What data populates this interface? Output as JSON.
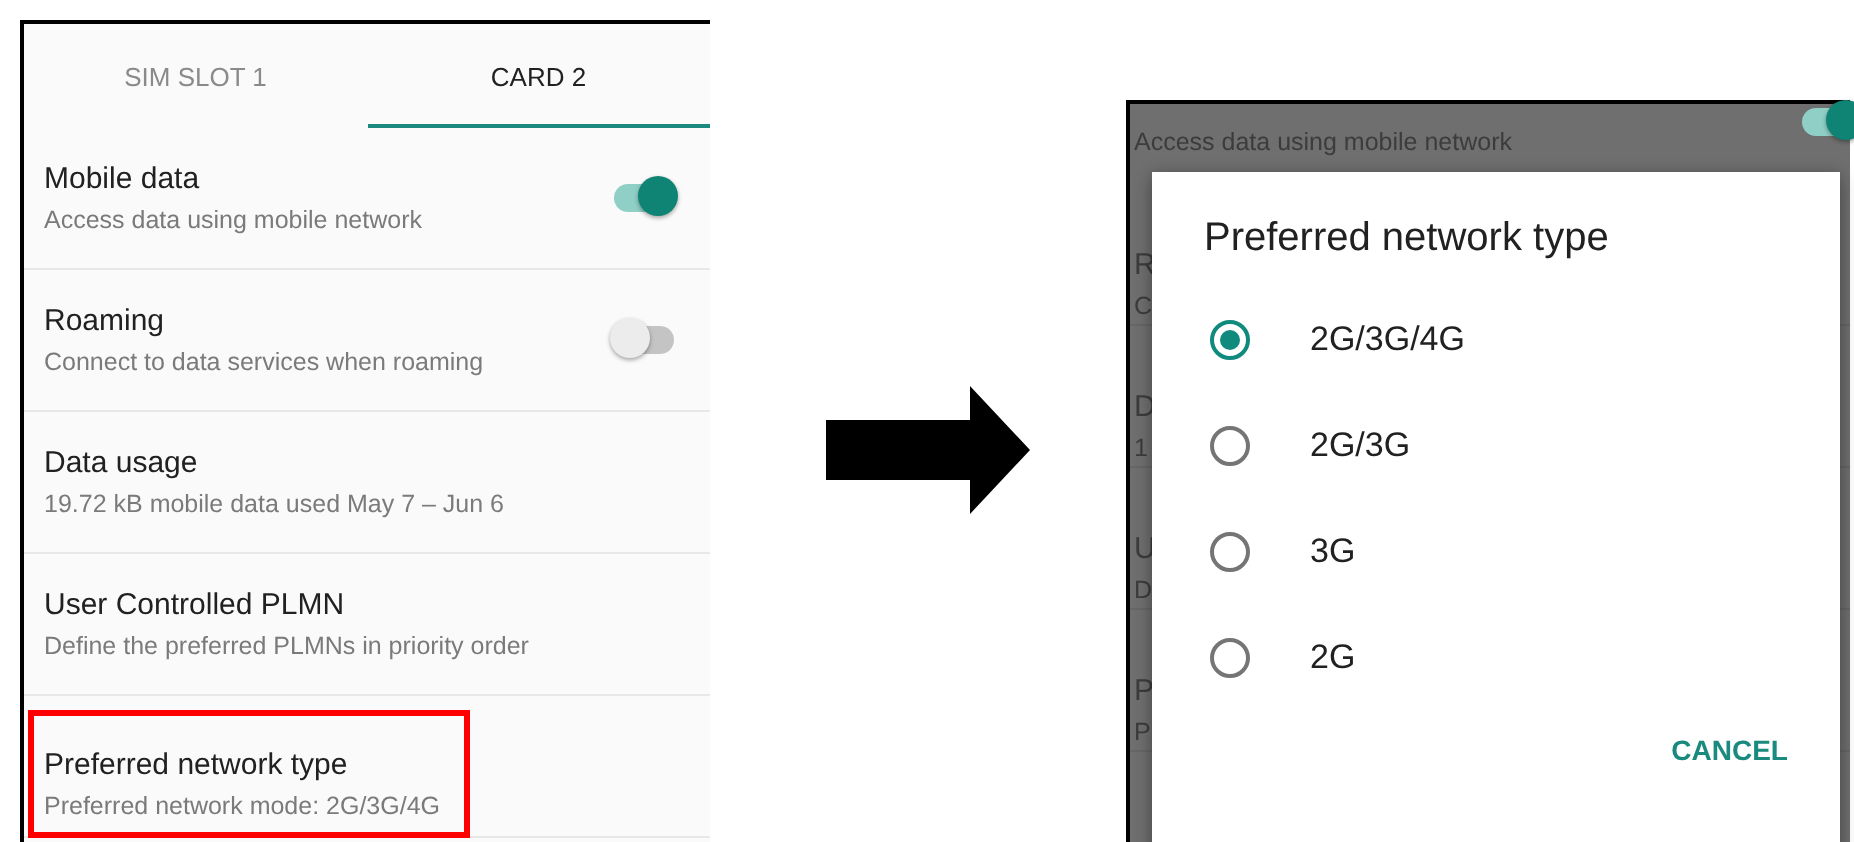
{
  "settings_screen": {
    "tabs": [
      {
        "label": "SIM SLOT 1",
        "selected": false
      },
      {
        "label": "CARD 2",
        "selected": true
      }
    ],
    "items": [
      {
        "kind": "toggle",
        "title": "Mobile data",
        "subtitle": "Access data using mobile network",
        "on": true,
        "highlighted": false
      },
      {
        "kind": "toggle",
        "title": "Roaming",
        "subtitle": "Connect to data services when roaming",
        "on": false,
        "highlighted": false
      },
      {
        "kind": "text",
        "title": "Data usage",
        "subtitle": "19.72 kB mobile data used May 7 – Jun 6",
        "highlighted": false
      },
      {
        "kind": "text",
        "title": "User Controlled PLMN",
        "subtitle": "Define the preferred PLMNs in priority order",
        "highlighted": false
      },
      {
        "kind": "text",
        "title": "Preferred network type",
        "subtitle": "Preferred network mode: 2G/3G/4G",
        "highlighted": true
      }
    ]
  },
  "dialog_screen": {
    "background": {
      "mobile_data_subtitle": "Access data using mobile network",
      "mobile_data_on": true,
      "rows": [
        {
          "title": "R",
          "subtitle": "C"
        },
        {
          "title": "D",
          "subtitle": "1"
        },
        {
          "title": "U",
          "subtitle": "D"
        },
        {
          "title": "P",
          "subtitle": "P"
        }
      ]
    },
    "dialog": {
      "title": "Preferred network type",
      "options": [
        {
          "label": "2G/3G/4G",
          "selected": true
        },
        {
          "label": "2G/3G",
          "selected": false
        },
        {
          "label": "3G",
          "selected": false
        },
        {
          "label": "2G",
          "selected": false
        }
      ],
      "button": "CANCEL"
    }
  }
}
